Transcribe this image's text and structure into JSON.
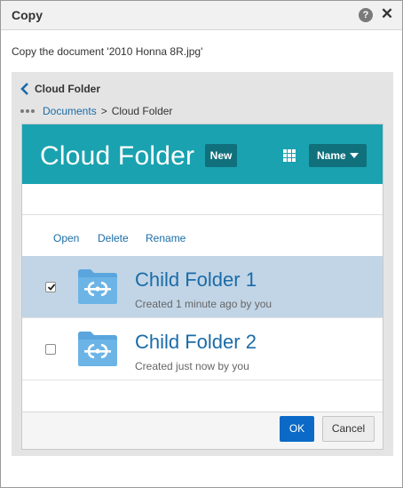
{
  "dialog": {
    "title": "Copy",
    "help_icon": "question-circle-icon",
    "close_icon": "close-x-icon",
    "message": "Copy the document '2010 Honna 8R.jpg'"
  },
  "navigation": {
    "back_label": "Cloud Folder",
    "breadcrumb": {
      "root": "Documents",
      "separator": ">",
      "current": "Cloud Folder"
    }
  },
  "picker": {
    "title": "Cloud Folder",
    "new_label": "New",
    "sort_label": "Name",
    "colors": {
      "header": "#1aa2b0",
      "header_button": "#10707c",
      "link": "#1a6ca8",
      "selected_row": "#c2d5e6",
      "primary_button": "#0b6ac7"
    },
    "actions": [
      "Open",
      "Delete",
      "Rename"
    ],
    "items": [
      {
        "name": "Child Folder 1",
        "meta": "Created 1 minute ago by you",
        "checked": true
      },
      {
        "name": "Child Folder 2",
        "meta": "Created just now by you",
        "checked": false
      }
    ]
  },
  "footer": {
    "ok_label": "OK",
    "cancel_label": "Cancel"
  }
}
